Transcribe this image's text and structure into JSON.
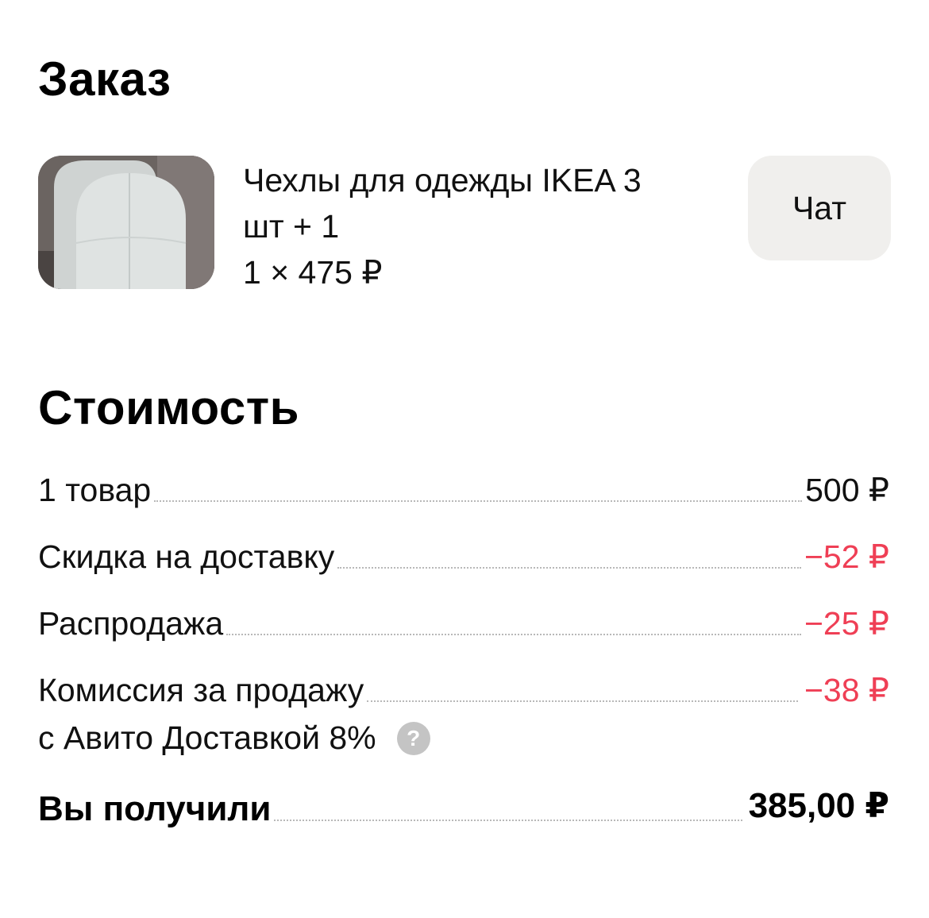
{
  "order": {
    "title": "Заказ",
    "product": {
      "name_line1": "Чехлы для одежды IKEA 3",
      "name_line2": "шт + 1",
      "quantity_price": "1 × 475 ₽"
    },
    "chat_label": "Чат"
  },
  "cost": {
    "title": "Стоимость",
    "rows": [
      {
        "label": "1 товар",
        "amount": "500 ₽"
      },
      {
        "label": "Скидка на доставку",
        "amount": "−52 ₽"
      },
      {
        "label": "Распродажа",
        "amount": "−25 ₽"
      },
      {
        "label": "Комиссия за продажу",
        "label_line2": "с Авито Доставкой 8%",
        "amount": "−38 ₽"
      }
    ],
    "help_icon_glyph": "?",
    "total": {
      "label": "Вы получили",
      "amount": "385,00 ₽"
    }
  },
  "colors": {
    "negative_amount": "#ef3f55",
    "chat_button_bg": "#f0efed",
    "help_icon_bg": "#c4c4c4"
  }
}
